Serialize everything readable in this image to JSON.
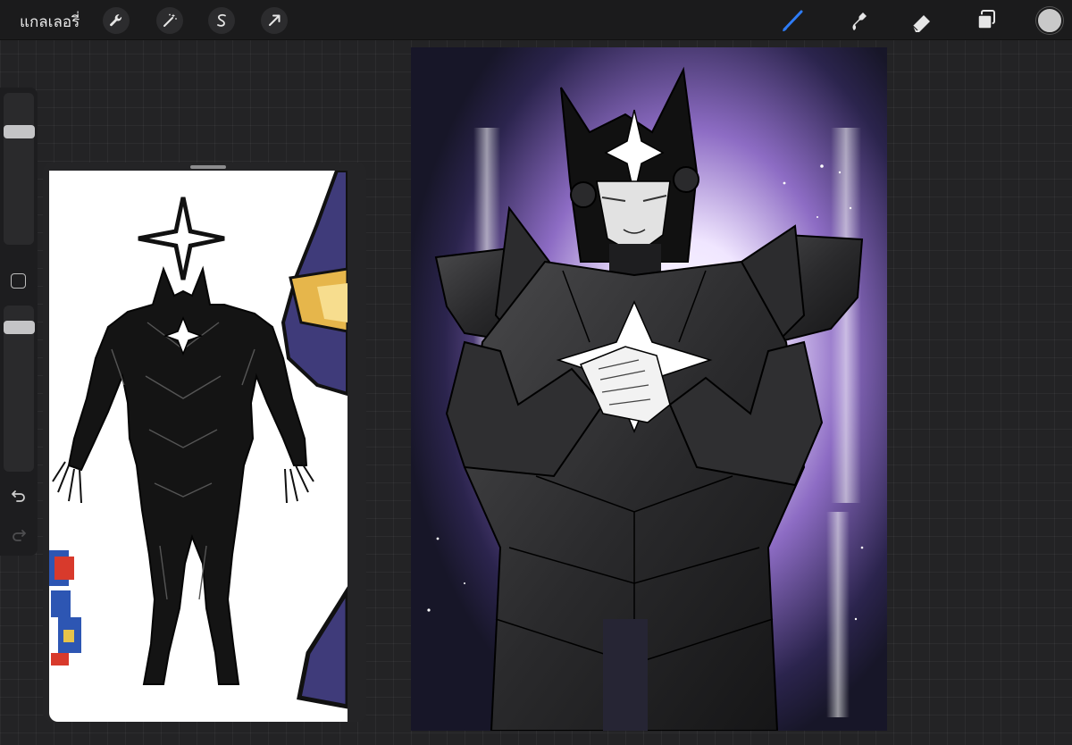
{
  "toolbar": {
    "gallery_label": "แกลเลอรี่",
    "left_tools": [
      "wrench-icon",
      "magic-wand-icon",
      "selection-icon",
      "transform-arrow-icon"
    ],
    "right_tools": [
      "brush-icon",
      "smudge-icon",
      "eraser-icon",
      "layers-icon"
    ],
    "active_tool": "brush-icon",
    "accent_color": "#2e7cf6",
    "current_color": "#c9c9c9"
  },
  "sidebar": {
    "size_slider_level": 0.92,
    "opacity_slider_level": 0.9,
    "buttons": [
      "modify-square-button",
      "undo-icon",
      "redo-icon"
    ]
  },
  "reference_window": {
    "visible": true
  },
  "canvas": {
    "background_colors": [
      "#1b1a2c",
      "#7a5fb0",
      "#ffffff"
    ]
  }
}
